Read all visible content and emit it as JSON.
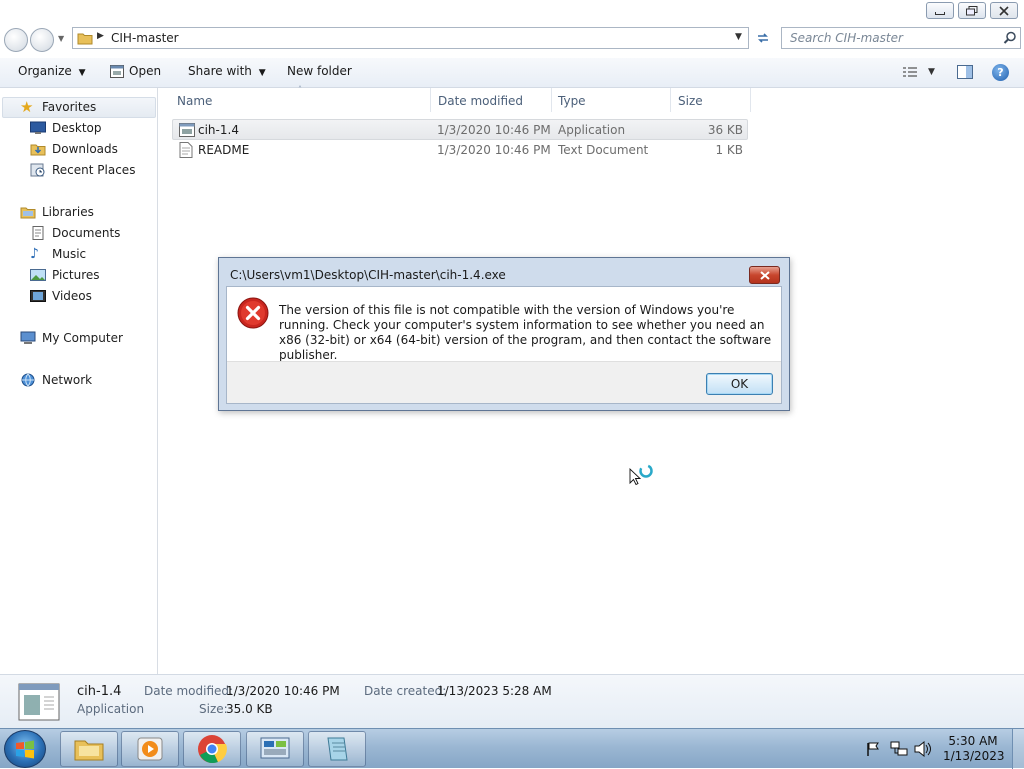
{
  "window": {
    "controls": {
      "minimize": "▭",
      "restore": "❐",
      "close": "✕"
    }
  },
  "address": {
    "path": "CIH-master",
    "search_placeholder": "Search CIH-master"
  },
  "toolbar": {
    "organize": "Organize",
    "open": "Open",
    "share_with": "Share with",
    "new_folder": "New folder"
  },
  "nav": {
    "favorites": "Favorites",
    "favorites_items": [
      "Desktop",
      "Downloads",
      "Recent Places"
    ],
    "libraries": "Libraries",
    "libraries_items": [
      "Documents",
      "Music",
      "Pictures",
      "Videos"
    ],
    "my_computer": "My Computer",
    "network": "Network"
  },
  "files": {
    "columns": [
      "Name",
      "Date modified",
      "Type",
      "Size"
    ],
    "rows": [
      {
        "name": "cih-1.4",
        "date": "1/3/2020 10:46 PM",
        "type": "Application",
        "size": "36 KB",
        "selected": true
      },
      {
        "name": "README",
        "date": "1/3/2020 10:46 PM",
        "type": "Text Document",
        "size": "1 KB",
        "selected": false
      }
    ]
  },
  "dialog": {
    "title": "C:\\Users\\vm1\\Desktop\\CIH-master\\cih-1.4.exe",
    "message": "The version of this file is not compatible with the version of Windows you're running. Check your computer's system information to see whether you need an x86 (32-bit) or x64 (64-bit) version of the program, and then contact the software publisher.",
    "ok": "OK",
    "close_glyph": "x"
  },
  "details": {
    "name": "cih-1.4",
    "type": "Application",
    "date_modified_label": "Date modified:",
    "date_modified": "1/3/2020 10:46 PM",
    "size_label": "Size:",
    "size": "35.0 KB",
    "date_created_label": "Date created:",
    "date_created": "1/13/2023 5:28 AM"
  },
  "taskbar": {
    "time": "5:30 AM",
    "date": "1/13/2023"
  },
  "colors": {
    "accent": "#3c7fb1",
    "error_red": "#d32f2f",
    "taskbar": "#9bb7d3"
  }
}
